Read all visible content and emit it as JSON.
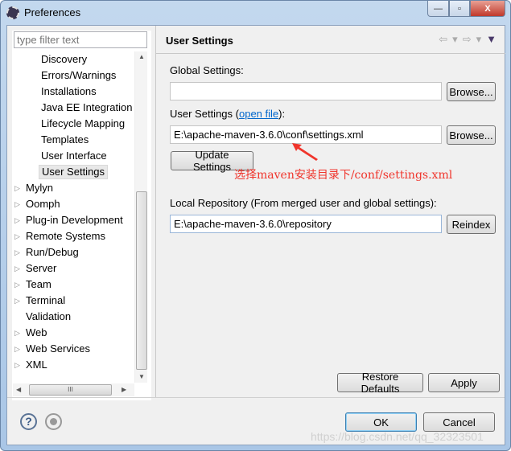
{
  "window": {
    "title": "Preferences",
    "controls": {
      "minimize": "—",
      "maximize": "▫",
      "close": "X"
    }
  },
  "sidebar": {
    "filter_placeholder": "type filter text",
    "items": [
      {
        "label": "Discovery",
        "level": 2
      },
      {
        "label": "Errors/Warnings",
        "level": 2
      },
      {
        "label": "Installations",
        "level": 2
      },
      {
        "label": "Java EE Integration",
        "level": 2
      },
      {
        "label": "Lifecycle Mapping",
        "level": 2
      },
      {
        "label": "Templates",
        "level": 2
      },
      {
        "label": "User Interface",
        "level": 2
      },
      {
        "label": "User Settings",
        "level": 2,
        "selected": true
      },
      {
        "label": "Mylyn",
        "expandable": true
      },
      {
        "label": "Oomph",
        "expandable": true
      },
      {
        "label": "Plug-in Development",
        "expandable": true
      },
      {
        "label": "Remote Systems",
        "expandable": true
      },
      {
        "label": "Run/Debug",
        "expandable": true
      },
      {
        "label": "Server",
        "expandable": true
      },
      {
        "label": "Team",
        "expandable": true
      },
      {
        "label": "Terminal",
        "expandable": true
      },
      {
        "label": "Validation",
        "expandable": false
      },
      {
        "label": "Web",
        "expandable": true
      },
      {
        "label": "Web Services",
        "expandable": true
      },
      {
        "label": "XML",
        "expandable": true
      }
    ],
    "hscroll_grip": "III"
  },
  "page": {
    "title": "User Settings",
    "global_label": "Global Settings:",
    "global_value": "",
    "browse": "Browse...",
    "user_label_pre": "User Settings (",
    "open_file": "open file",
    "user_label_post": "):",
    "user_value": "E:\\apache-maven-3.6.0\\conf\\settings.xml",
    "update_settings": "Update Settings",
    "annotation": "选择maven安装目录下/conf/settings.xml",
    "local_label": "Local Repository (From merged user and global settings):",
    "local_value": "E:\\apache-maven-3.6.0\\repository",
    "reindex": "Reindex",
    "restore_defaults": "Restore Defaults",
    "apply": "Apply"
  },
  "footer": {
    "ok": "OK",
    "cancel": "Cancel",
    "watermark": "https://blog.csdn.net/qq_32323501"
  },
  "colors": {
    "annotation": "#f0352c",
    "link": "#0066cc"
  }
}
